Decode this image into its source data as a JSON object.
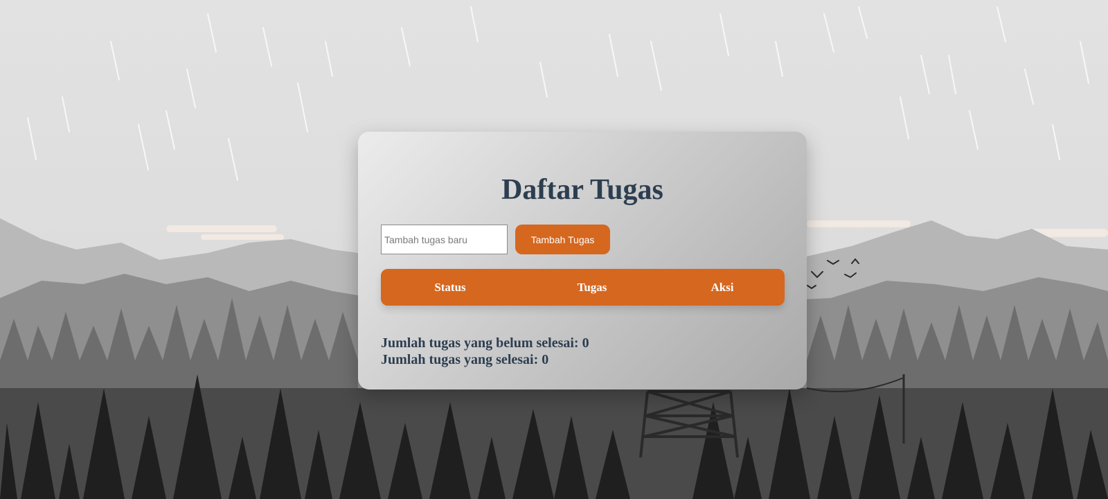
{
  "app": {
    "title": "Daftar Tugas"
  },
  "form": {
    "input_placeholder": "Tambah tugas baru",
    "input_value": "",
    "add_button_label": "Tambah Tugas"
  },
  "table": {
    "headers": [
      "Status",
      "Tugas",
      "Aksi"
    ],
    "rows": []
  },
  "stats": {
    "pending_label": "Jumlah tugas yang belum selesai: 0",
    "done_label": "Jumlah tugas yang selesai: 0"
  },
  "colors": {
    "accent": "#d5671f",
    "title": "#2c3e50"
  }
}
